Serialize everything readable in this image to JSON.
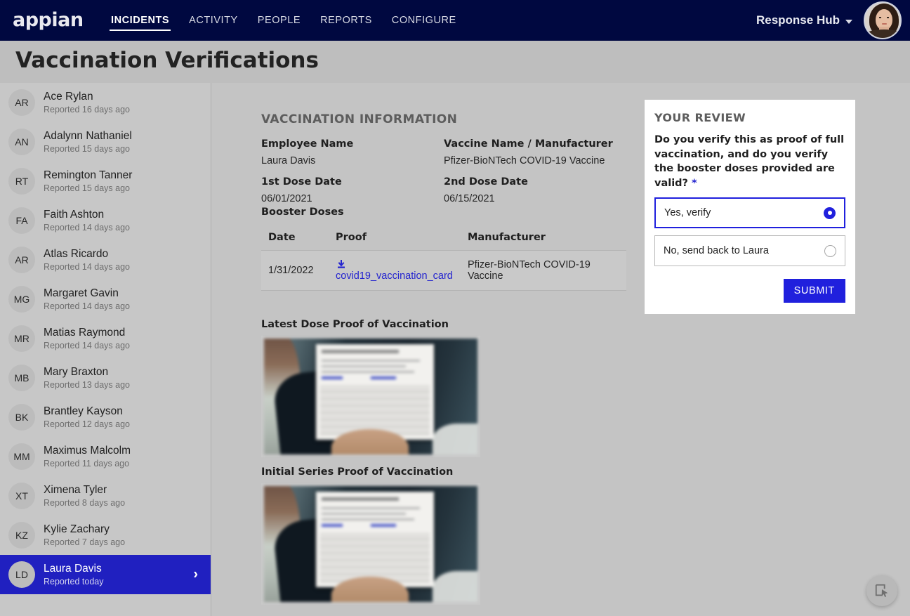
{
  "nav": {
    "logo_text": "appian",
    "logo_icon": "appian-logo",
    "links": [
      {
        "label": "INCIDENTS",
        "active": true
      },
      {
        "label": "ACTIVITY",
        "active": false
      },
      {
        "label": "PEOPLE",
        "active": false
      },
      {
        "label": "REPORTS",
        "active": false
      },
      {
        "label": "CONFIGURE",
        "active": false
      }
    ],
    "hub_label": "Response Hub",
    "caret_icon": "chevron-down-icon",
    "avatar_icon": "user-avatar-photo"
  },
  "page": {
    "title": "Vaccination Verifications"
  },
  "sidebar": {
    "items": [
      {
        "initials": "AR",
        "name": "Ace Rylan",
        "meta": "Reported 16 days ago",
        "selected": false
      },
      {
        "initials": "AN",
        "name": "Adalynn Nathaniel",
        "meta": "Reported 15 days ago",
        "selected": false
      },
      {
        "initials": "RT",
        "name": "Remington Tanner",
        "meta": "Reported 15 days ago",
        "selected": false
      },
      {
        "initials": "FA",
        "name": "Faith Ashton",
        "meta": "Reported 14 days ago",
        "selected": false
      },
      {
        "initials": "AR",
        "name": "Atlas Ricardo",
        "meta": "Reported 14 days ago",
        "selected": false
      },
      {
        "initials": "MG",
        "name": "Margaret Gavin",
        "meta": "Reported 14 days ago",
        "selected": false
      },
      {
        "initials": "MR",
        "name": "Matias Raymond",
        "meta": "Reported 14 days ago",
        "selected": false
      },
      {
        "initials": "MB",
        "name": "Mary Braxton",
        "meta": "Reported 13 days ago",
        "selected": false
      },
      {
        "initials": "BK",
        "name": "Brantley Kayson",
        "meta": "Reported 12 days ago",
        "selected": false
      },
      {
        "initials": "MM",
        "name": "Maximus Malcolm",
        "meta": "Reported 11 days ago",
        "selected": false
      },
      {
        "initials": "XT",
        "name": "Ximena Tyler",
        "meta": "Reported 8 days ago",
        "selected": false
      },
      {
        "initials": "KZ",
        "name": "Kylie Zachary",
        "meta": "Reported 7 days ago",
        "selected": false
      },
      {
        "initials": "LD",
        "name": "Laura Davis",
        "meta": "Reported today",
        "selected": true
      }
    ],
    "chevron_icon": "chevron-right-icon"
  },
  "vaccination": {
    "section_title": "VACCINATION INFORMATION",
    "fields": [
      {
        "label": "Employee Name",
        "value": "Laura Davis"
      },
      {
        "label": "Vaccine Name / Manufacturer",
        "value": "Pfizer-BioNTech COVID-19 Vaccine"
      },
      {
        "label": "1st Dose Date",
        "value": "06/01/2021"
      },
      {
        "label": "2nd Dose Date",
        "value": "06/15/2021"
      }
    ],
    "booster_label": "Booster Doses",
    "booster_table": {
      "columns": [
        "Date",
        "Proof",
        "Manufacturer"
      ],
      "rows": [
        {
          "date": "1/31/2022",
          "proof_link": "covid19_vaccination_card",
          "proof_icon": "download-icon",
          "manufacturer": "Pfizer-BioNTech COVID-19 Vaccine"
        }
      ]
    },
    "proofs": [
      {
        "label": "Latest Dose Proof of Vaccination",
        "image_icon": "vaccination-card-photo"
      },
      {
        "label": "Initial Series Proof of Vaccination",
        "image_icon": "vaccination-card-photo"
      }
    ]
  },
  "review": {
    "heading": "YOUR REVIEW",
    "question": "Do you verify this as proof of full vaccination, and do you verify the booster doses provided are valid?",
    "required_marker": "*",
    "options": [
      {
        "label": "Yes, verify",
        "selected": true
      },
      {
        "label": "No, send back to Laura",
        "selected": false
      }
    ],
    "submit_label": "SUBMIT"
  },
  "fab": {
    "icon": "cursor-select-icon"
  },
  "colors": {
    "nav_navy": "#000840",
    "accent_blue": "#2020c0",
    "link_blue": "#2424cf",
    "page_bg": "#c4c4c4",
    "title_bar": "#bebebe",
    "sidebar_bg": "#c7c7c7",
    "card_bg": "#ffffff"
  }
}
